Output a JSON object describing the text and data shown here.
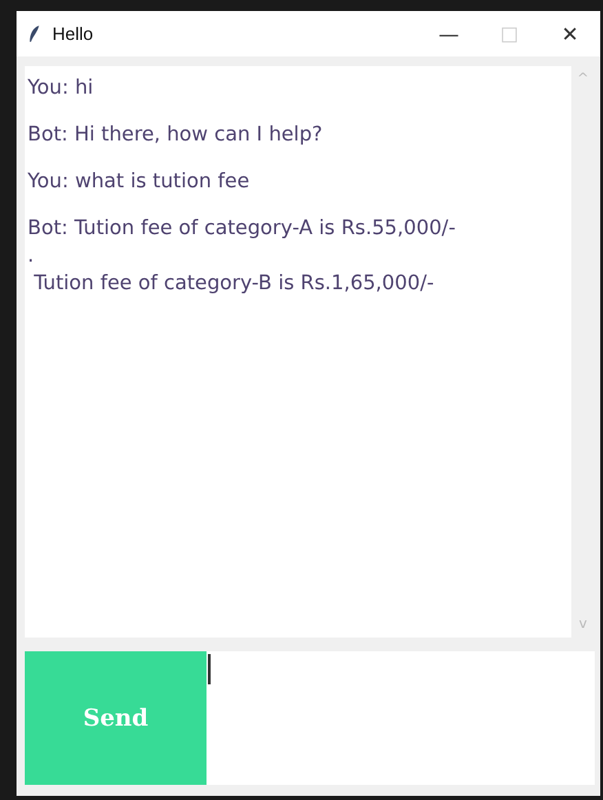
{
  "window": {
    "title": "Hello",
    "controls": [
      "—",
      "□",
      "✕"
    ]
  },
  "messages": [
    {
      "lines": [
        "You: hi"
      ]
    },
    {
      "lines": [
        "Bot: Hi there, how can I help?"
      ]
    },
    {
      "lines": [
        "You: what is tution fee"
      ]
    },
    {
      "lines": [
        "Bot: Tution fee of category-A is Rs.55,000/-",
        ".",
        " Tution fee of category-B is Rs.1,65,000/-"
      ]
    }
  ],
  "send_button": {
    "label": "Send"
  },
  "scrollbar": {
    "up": "^",
    "down": "v"
  }
}
